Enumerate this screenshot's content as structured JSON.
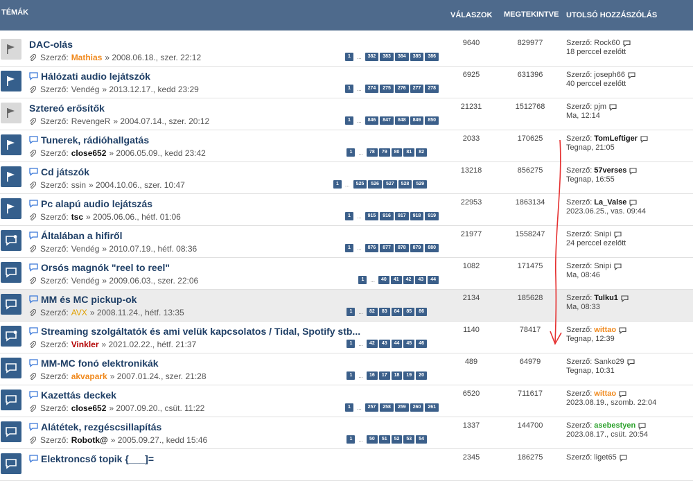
{
  "header": {
    "topics": "TÉMÁK",
    "replies": "VÁLASZOK",
    "views": "MEGTEKINTVE",
    "last_post": "UTOLSÓ HOZZÁSZÓLÁS"
  },
  "by_prefix": "Szerző:",
  "rows": [
    {
      "icon": "flag",
      "style": "grey",
      "title": "DAC-olás",
      "bubble": false,
      "author": "Mathias",
      "author_style": "orange",
      "date": "» 2008.06.18., szer. 22:12",
      "pages": [
        "1",
        "...",
        "382",
        "383",
        "384",
        "385",
        "386"
      ],
      "replies": "9640",
      "views": "829977",
      "last_author": "Rock60",
      "last_style": "",
      "last_time": "18 perccel ezelőtt"
    },
    {
      "icon": "flag",
      "style": "blue",
      "title": "Hálózati audio lejátszók",
      "bubble": true,
      "author": "Vendég",
      "author_style": "",
      "date": "» 2013.12.17., kedd 23:29",
      "pages": [
        "1",
        "...",
        "274",
        "275",
        "276",
        "277",
        "278"
      ],
      "replies": "6925",
      "views": "631396",
      "last_author": "joseph66",
      "last_style": "",
      "last_time": "40 perccel ezelőtt"
    },
    {
      "icon": "flag",
      "style": "grey",
      "title": "Sztereó erősítők",
      "bubble": false,
      "author": "RevengeR",
      "author_style": "",
      "date": "» 2004.07.14., szer. 20:12",
      "pages": [
        "1",
        "...",
        "846",
        "847",
        "848",
        "849",
        "850"
      ],
      "replies": "21231",
      "views": "1512768",
      "last_author": "pjm",
      "last_style": "",
      "last_time": "Ma, 12:14"
    },
    {
      "icon": "flag",
      "style": "blue",
      "title": "Tunerek, rádióhallgatás",
      "bubble": true,
      "author": "close652",
      "author_style": "bold",
      "date": "» 2006.05.09., kedd 23:42",
      "pages": [
        "1",
        "...",
        "78",
        "79",
        "80",
        "81",
        "82"
      ],
      "replies": "2033",
      "views": "170625",
      "last_author": "TomLeftiger",
      "last_style": "bold",
      "last_time": "Tegnap, 21:05"
    },
    {
      "icon": "flag",
      "style": "blue",
      "title": "Cd játszók",
      "bubble": true,
      "author": "ssin",
      "author_style": "",
      "date": "» 2004.10.06., szer. 10:47",
      "pages": [
        "1",
        "...",
        "525",
        "526",
        "527",
        "528",
        "529"
      ],
      "replies": "13218",
      "views": "856275",
      "last_author": "57verses",
      "last_style": "bold",
      "last_time": "Tegnap, 16:55"
    },
    {
      "icon": "flag",
      "style": "blue",
      "title": "Pc alapú audio lejátszás",
      "bubble": true,
      "author": "tsc",
      "author_style": "bold",
      "date": "» 2005.06.06., hétf. 01:06",
      "pages": [
        "1",
        "...",
        "915",
        "916",
        "917",
        "918",
        "919"
      ],
      "replies": "22953",
      "views": "1863134",
      "last_author": "La_Valse",
      "last_style": "bold",
      "last_time": "2023.06.25., vas. 09:44"
    },
    {
      "icon": "chat-dot",
      "style": "blue",
      "title": "Általában a hifiről",
      "bubble": true,
      "author": "Vendég",
      "author_style": "",
      "date": "» 2010.07.19., hétf. 08:36",
      "pages": [
        "1",
        "...",
        "876",
        "877",
        "878",
        "879",
        "880"
      ],
      "replies": "21977",
      "views": "1558247",
      "last_author": "Snipi",
      "last_style": "",
      "last_time": "24 perccel ezelőtt"
    },
    {
      "icon": "chat",
      "style": "blue",
      "title": "Orsós magnók \"reel to reel\"",
      "bubble": true,
      "author": "Vendég",
      "author_style": "",
      "date": "» 2009.06.03., szer. 22:06",
      "pages": [
        "1",
        "...",
        "40",
        "41",
        "42",
        "43",
        "44"
      ],
      "replies": "1082",
      "views": "171475",
      "last_author": "Snipi",
      "last_style": "",
      "last_time": "Ma, 08:46"
    },
    {
      "icon": "chat",
      "style": "blue",
      "title": "MM és MC pickup-ok",
      "bubble": true,
      "author": "AVX",
      "author_style": "gold",
      "date": "» 2008.11.24., hétf. 13:35",
      "pages": [
        "1",
        "...",
        "82",
        "83",
        "84",
        "85",
        "86"
      ],
      "replies": "2134",
      "views": "185628",
      "last_author": "Tulku1",
      "last_style": "bold",
      "last_time": "Ma, 08:33",
      "highlight": true
    },
    {
      "icon": "chat-dot",
      "style": "blue",
      "title": "Streaming szolgáltatók és ami velük kapcsolatos / Tidal, Spotify stb...",
      "bubble": true,
      "author": "Vinkler",
      "author_style": "red",
      "date": "» 2021.02.22., hétf. 21:37",
      "pages": [
        "1",
        "...",
        "42",
        "43",
        "44",
        "45",
        "46"
      ],
      "replies": "1140",
      "views": "78417",
      "last_author": "wittao",
      "last_style": "orange",
      "last_time": "Tegnap, 12:39"
    },
    {
      "icon": "chat",
      "style": "blue",
      "title": "MM-MC fonó elektronikák",
      "bubble": true,
      "author": "akvapark",
      "author_style": "orange",
      "date": "» 2007.01.24., szer. 21:28",
      "pages": [
        "1",
        "...",
        "16",
        "17",
        "18",
        "19",
        "20"
      ],
      "replies": "489",
      "views": "64979",
      "last_author": "Sanko29",
      "last_style": "",
      "last_time": "Tegnap, 10:31"
    },
    {
      "icon": "chat",
      "style": "blue",
      "title": "Kazettás deckek",
      "bubble": true,
      "author": "close652",
      "author_style": "bold",
      "date": "» 2007.09.20., csüt. 11:22",
      "pages": [
        "1",
        "...",
        "257",
        "258",
        "259",
        "260",
        "261"
      ],
      "replies": "6520",
      "views": "711617",
      "last_author": "wittao",
      "last_style": "orange",
      "last_time": "2023.08.19., szomb. 22:04"
    },
    {
      "icon": "chat",
      "style": "blue",
      "title": "Alátétek, rezgéscsillapítás",
      "bubble": true,
      "author": "Robotk@",
      "author_style": "bold",
      "date": "» 2005.09.27., kedd 15:46",
      "pages": [
        "1",
        "...",
        "50",
        "51",
        "52",
        "53",
        "54"
      ],
      "replies": "1337",
      "views": "144700",
      "last_author": "asebestyen",
      "last_style": "green",
      "last_time": "2023.08.17., csüt. 20:54"
    },
    {
      "icon": "chat",
      "style": "blue",
      "title": "Elektroncső topik {___]=",
      "bubble": true,
      "author": "",
      "author_style": "",
      "date": "",
      "pages": [],
      "replies": "2345",
      "views": "186275",
      "last_author": "liget65",
      "last_style": "",
      "last_time": ""
    }
  ],
  "pages_right": [
    633,
    633,
    633,
    616,
    616,
    633,
    633,
    633,
    616,
    616,
    616,
    633,
    616,
    616
  ],
  "colors": {
    "header_bg": "#4e6a8c",
    "page_btn": "#3b5f8a",
    "icon_blue": "#355f8c",
    "annotation_arrow": "#e53030"
  }
}
